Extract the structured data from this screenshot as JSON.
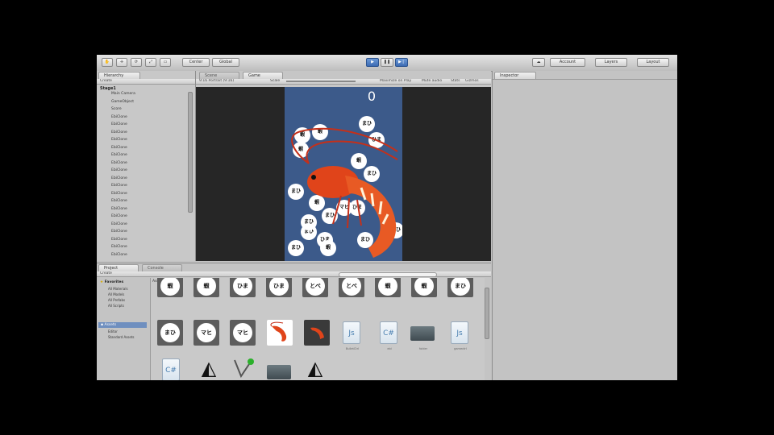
{
  "toolbar": {
    "pivot_label": "Center",
    "space_label": "Global",
    "layers_label": "Layers",
    "layout_label": "Layout",
    "account_label": "Account"
  },
  "hierarchy": {
    "tab": "Hierarchy",
    "create_label": "Create",
    "scene_name": "Stage1",
    "items": [
      "Main Camera",
      "GameObject",
      "Score",
      "EbiClone",
      "EbiClone",
      "EbiClone",
      "EbiClone",
      "EbiClone",
      "EbiClone",
      "EbiClone",
      "EbiClone",
      "EbiClone",
      "EbiClone",
      "EbiClone",
      "EbiClone",
      "EbiClone",
      "EbiClone",
      "EbiClone",
      "EbiClone",
      "EbiClone",
      "EbiClone",
      "EbiClone"
    ]
  },
  "views": {
    "scene_tab": "Scene",
    "game_tab": "Game",
    "aspect_label": "9:16 Portrait (9:16)",
    "scale_label": "Scale",
    "maximize_label": "Maximize on Play",
    "mute_label": "Mute audio",
    "stats_label": "Stats",
    "gizmos_label": "Gizmos"
  },
  "game": {
    "score": "0",
    "bubbles": [
      "まひ",
      "蝦",
      "蝦",
      "まひ",
      "まひ",
      "蝦",
      "ひま",
      "蝦",
      "蝦",
      "ひま",
      "まひ",
      "ひま",
      "マヒ",
      "まひ",
      "まひ",
      "まひ",
      "蝦",
      "まひ",
      "蝦",
      "まひ"
    ]
  },
  "inspector": {
    "tab": "Inspector"
  },
  "project": {
    "tab": "Project",
    "console_tab": "Console",
    "create_label": "Create",
    "favorites_label": "Favorites",
    "favorites": [
      "All Materials",
      "All Models",
      "All Prefabs",
      "All Scripts"
    ],
    "assets_label": "Assets",
    "folders": [
      "Editor",
      "Standard Assets"
    ],
    "breadcrumb": "Assets",
    "row1": [
      "蝦",
      "蝦",
      "ひま",
      "ひま",
      "とべ",
      "とべ",
      "蝦",
      "蝦",
      "まひ"
    ],
    "row2": [
      "まひ",
      "マヒ",
      "マヒ"
    ],
    "doc_labels": [
      "Js",
      "C#",
      "Js"
    ],
    "names_row2": [
      "BulletCtrl",
      "ebi",
      "folder",
      "gamectrl"
    ]
  },
  "colors": {
    "game_bg": "#3c5a8a",
    "shrimp": "#e0441a",
    "accent_blue": "#3c6bb3"
  }
}
